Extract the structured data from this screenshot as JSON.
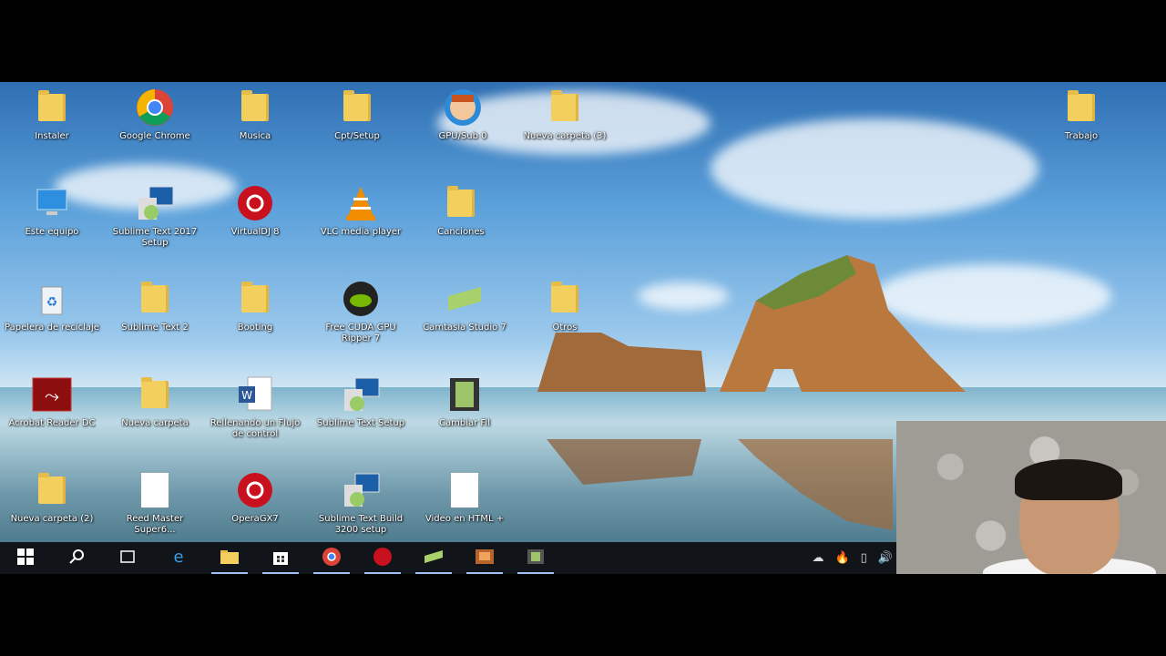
{
  "desktop": {
    "icons": [
      {
        "label": "Instaler",
        "type": "folder"
      },
      {
        "label": "Google Chrome",
        "type": "chrome"
      },
      {
        "label": "Musica",
        "type": "folder"
      },
      {
        "label": "Cpt/Setup",
        "type": "folder"
      },
      {
        "label": "GPU/Sub 0",
        "type": "app"
      },
      {
        "label": "Nueva carpeta (3)",
        "type": "folder"
      },
      {
        "label": "Trabajo",
        "type": "folder"
      },
      {
        "label": "Este equipo",
        "type": "pc"
      },
      {
        "label": "Sublime Text 2017 Setup",
        "type": "installer"
      },
      {
        "label": "VirtualDJ 8",
        "type": "app-red"
      },
      {
        "label": "VLC media player",
        "type": "vlc"
      },
      {
        "label": "Canciones",
        "type": "folder"
      },
      {
        "label": "Papelera de reciclaje",
        "type": "recycle"
      },
      {
        "label": "Sublime Text 2",
        "type": "folder"
      },
      {
        "label": "Booting",
        "type": "folder"
      },
      {
        "label": "Free CUDA GPU Ripper 7",
        "type": "nvidia"
      },
      {
        "label": "Camtasia Studio 7",
        "type": "camtasia"
      },
      {
        "label": "Otros",
        "type": "folder"
      },
      {
        "label": "Acrobat Reader DC",
        "type": "acrobat"
      },
      {
        "label": "Nueva carpeta",
        "type": "folder"
      },
      {
        "label": "Rellenando un Flujo de control",
        "type": "word"
      },
      {
        "label": "Sublime Text Setup",
        "type": "installer"
      },
      {
        "label": "Cambiar Fil",
        "type": "film"
      },
      {
        "label": "Nueva carpeta (2)",
        "type": "folder"
      },
      {
        "label": "Reed Master Super6...",
        "type": "doc"
      },
      {
        "label": "OperaGX7",
        "type": "app-red"
      },
      {
        "label": "Sublime Text Build 3200 setup",
        "type": "installer"
      },
      {
        "label": "Video en HTML +",
        "type": "doc"
      }
    ]
  },
  "taskbar": {
    "buttons": [
      {
        "name": "start",
        "icon": "windows-icon"
      },
      {
        "name": "search",
        "icon": "search-icon"
      },
      {
        "name": "task-view",
        "icon": "task-view-icon"
      },
      {
        "name": "edge",
        "icon": "edge-icon"
      },
      {
        "name": "file-explorer",
        "icon": "folder-icon"
      },
      {
        "name": "store",
        "icon": "store-icon"
      },
      {
        "name": "chrome",
        "icon": "chrome-icon"
      },
      {
        "name": "app-red",
        "icon": "app-icon"
      },
      {
        "name": "camtasia",
        "icon": "camtasia-icon"
      },
      {
        "name": "recorder",
        "icon": "recorder-icon"
      },
      {
        "name": "film",
        "icon": "film-icon"
      }
    ],
    "tray": [
      "cloud-icon",
      "flame-icon",
      "usb-icon",
      "volume-icon"
    ]
  },
  "colors": {
    "taskbar": "#111418",
    "folder": "#f3cf5d",
    "accent": "#9fc5f0"
  }
}
